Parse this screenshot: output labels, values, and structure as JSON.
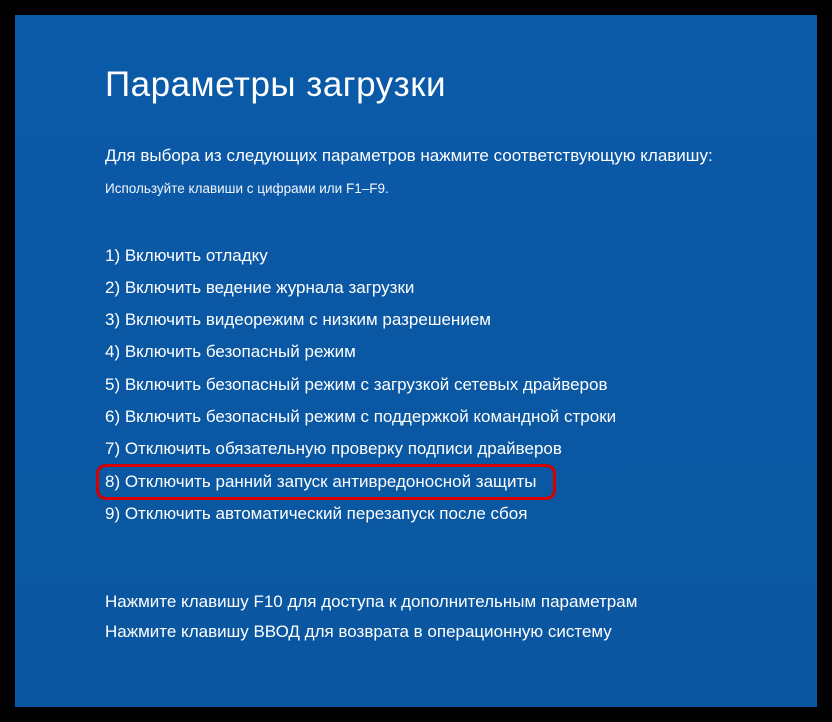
{
  "title": "Параметры загрузки",
  "subtitle": "Для выбора из следующих параметров нажмите соответствующую клавишу:",
  "hint": "Используйте клавиши с цифрами или F1–F9.",
  "options": [
    {
      "num": "1",
      "label": "Включить отладку",
      "highlighted": false
    },
    {
      "num": "2",
      "label": "Включить ведение журнала загрузки",
      "highlighted": false
    },
    {
      "num": "3",
      "label": "Включить видеорежим с низким разрешением",
      "highlighted": false
    },
    {
      "num": "4",
      "label": "Включить безопасный режим",
      "highlighted": false
    },
    {
      "num": "5",
      "label": "Включить безопасный режим с загрузкой сетевых драйверов",
      "highlighted": false
    },
    {
      "num": "6",
      "label": "Включить безопасный режим с поддержкой командной строки",
      "highlighted": false
    },
    {
      "num": "7",
      "label": "Отключить обязательную проверку подписи драйверов",
      "highlighted": false
    },
    {
      "num": "8",
      "label": "Отключить ранний запуск антивредоносной защиты",
      "highlighted": true
    },
    {
      "num": "9",
      "label": "Отключить автоматический перезапуск после сбоя",
      "highlighted": false
    }
  ],
  "footer_line1": "Нажмите клавишу F10 для доступа к дополнительным параметрам",
  "footer_line2": "Нажмите клавишу ВВОД для возврата в операционную систему"
}
